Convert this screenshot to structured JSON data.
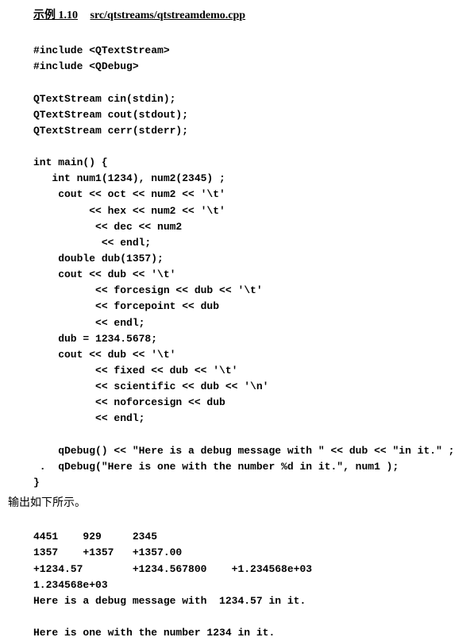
{
  "header": {
    "example_label": "示例 1.10",
    "file_path": "src/qtstreams/qtstreamdemo.cpp"
  },
  "code": {
    "l01": "#include <QTextStream>",
    "l02": "#include <QDebug>",
    "l03": "",
    "l04": "QTextStream cin(stdin);",
    "l05": "QTextStream cout(stdout);",
    "l06": "QTextStream cerr(stderr);",
    "l07": "",
    "l08": "int main() {",
    "l09": "   int num1(1234), num2(2345) ;",
    "l10": "    cout << oct << num2 << '\\t'",
    "l11": "         << hex << num2 << '\\t'",
    "l12": "          << dec << num2",
    "l13": "           << endl;",
    "l14": "    double dub(1357);",
    "l15": "    cout << dub << '\\t'",
    "l16": "          << forcesign << dub << '\\t'",
    "l17": "          << forcepoint << dub",
    "l18": "          << endl;",
    "l19": "    dub = 1234.5678;",
    "l20": "    cout << dub << '\\t'",
    "l21": "          << fixed << dub << '\\t'",
    "l22": "          << scientific << dub << '\\n'",
    "l23": "          << noforcesign << dub",
    "l24": "          << endl;",
    "l25": "",
    "l26": "    qDebug() << \"Here is a debug message with \" << dub << \"in it.\" ;",
    "l27": " .  qDebug(\"Here is one with the number %d in it.\", num1 );",
    "l28": "}"
  },
  "output_intro": "输出如下所示。",
  "output": {
    "l1": "4451    929     2345",
    "l2": "1357    +1357   +1357.00",
    "l3": "+1234.57        +1234.567800    +1.234568e+03",
    "l4": "1.234568e+03",
    "l5": "Here is a debug message with  1234.57 in it.",
    "l6": "",
    "l7": "Here is one with the number 1234 in it."
  }
}
